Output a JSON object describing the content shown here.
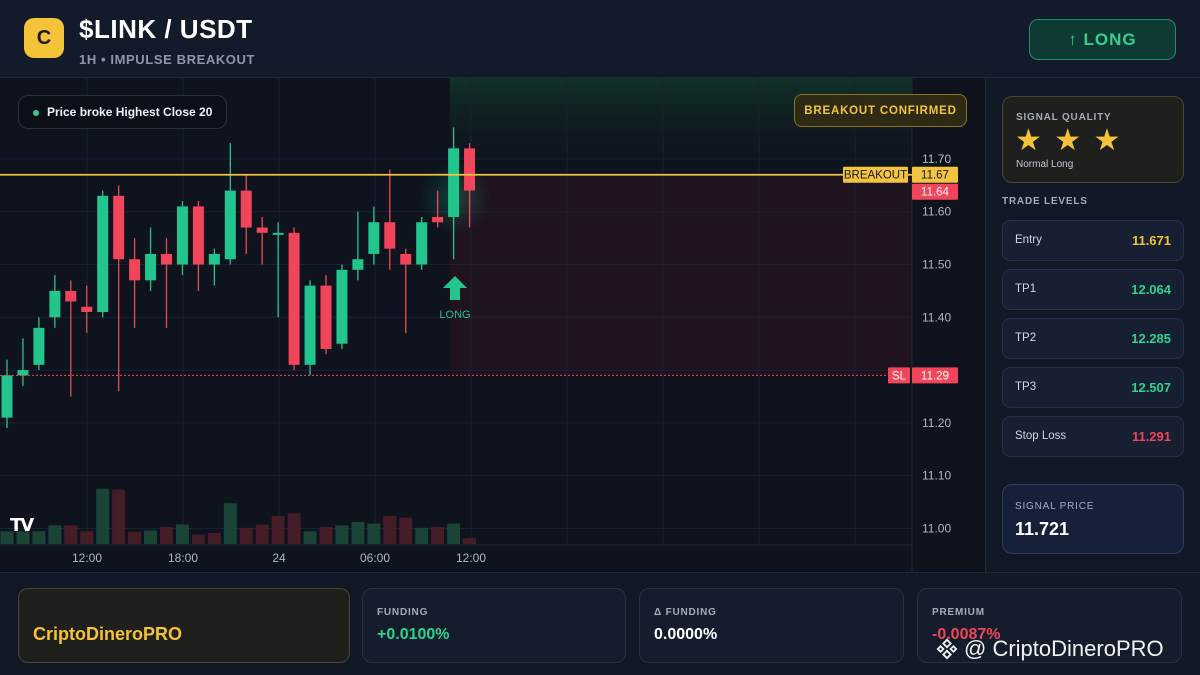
{
  "header": {
    "logo_letter": "C",
    "pair": "$LINK / USDT",
    "subtitle": "1H • IMPULSE BREAKOUT",
    "long_button": "↑ LONG"
  },
  "chart": {
    "info_pill": "Price broke Highest Close 20",
    "confirm_badge": "BREAKOUT CONFIRMED",
    "breakout_tag": "BREAKOUT",
    "breakout_value": "11.67",
    "last_price_value": "11.64",
    "sl_tag": "SL",
    "sl_value": "11.29",
    "long_marker_label": "LONG",
    "tv_logo": "TV"
  },
  "side": {
    "quality_label": "SIGNAL QUALITY",
    "quality_stars": "★ ★ ★",
    "quality_sub": "Normal Long",
    "levels_title": "TRADE LEVELS",
    "levels": [
      {
        "name": "Entry",
        "value": "11.671",
        "color": "#f5c338"
      },
      {
        "name": "TP1",
        "value": "12.064",
        "color": "#2ed28f"
      },
      {
        "name": "TP2",
        "value": "12.285",
        "color": "#2ed28f"
      },
      {
        "name": "TP3",
        "value": "12.507",
        "color": "#2ed28f"
      },
      {
        "name": "Stop Loss",
        "value": "11.291",
        "color": "#f0455a"
      }
    ],
    "signal_price_label": "SIGNAL PRICE",
    "signal_price_value": "11.721"
  },
  "bottom": {
    "brand": "CriptoDineroPRO",
    "funding_label": "FUNDING",
    "funding_value": "+0.0100%",
    "dfunding_label": "Δ FUNDING",
    "dfunding_value": "0.0000%",
    "premium_label": "PREMIUM",
    "premium_value": "-0.0087%",
    "watermark": "@ CriptoDineroPRO"
  },
  "colors": {
    "up": "#22c58b",
    "down": "#f0455a",
    "breakout": "#f2c440",
    "background": "#0e131d"
  },
  "chart_data": {
    "type": "candlestick",
    "y_ticks": [
      "11.70",
      "11.60",
      "11.50",
      "11.40",
      "11.20",
      "11.10",
      "11.00"
    ],
    "x_ticks": [
      "12:00",
      "18:00",
      "24",
      "06:00",
      "12:00"
    ],
    "ylim": [
      10.99,
      11.83
    ],
    "breakout_level": 11.67,
    "stop_loss_level": 11.29,
    "candles": [
      {
        "o": 11.21,
        "c": 11.29,
        "h": 11.32,
        "l": 11.19
      },
      {
        "o": 11.29,
        "c": 11.3,
        "h": 11.36,
        "l": 11.27
      },
      {
        "o": 11.31,
        "c": 11.38,
        "h": 11.4,
        "l": 11.3
      },
      {
        "o": 11.4,
        "c": 11.45,
        "h": 11.48,
        "l": 11.38
      },
      {
        "o": 11.45,
        "c": 11.43,
        "h": 11.47,
        "l": 11.25
      },
      {
        "o": 11.42,
        "c": 11.41,
        "h": 11.46,
        "l": 11.37
      },
      {
        "o": 11.41,
        "c": 11.63,
        "h": 11.64,
        "l": 11.4
      },
      {
        "o": 11.63,
        "c": 11.51,
        "h": 11.65,
        "l": 11.26
      },
      {
        "o": 11.51,
        "c": 11.47,
        "h": 11.55,
        "l": 11.38
      },
      {
        "o": 11.47,
        "c": 11.52,
        "h": 11.57,
        "l": 11.45
      },
      {
        "o": 11.52,
        "c": 11.5,
        "h": 11.55,
        "l": 11.38
      },
      {
        "o": 11.5,
        "c": 11.61,
        "h": 11.62,
        "l": 11.48
      },
      {
        "o": 11.61,
        "c": 11.5,
        "h": 11.62,
        "l": 11.45
      },
      {
        "o": 11.5,
        "c": 11.52,
        "h": 11.53,
        "l": 11.46
      },
      {
        "o": 11.51,
        "c": 11.64,
        "h": 11.73,
        "l": 11.5
      },
      {
        "o": 11.64,
        "c": 11.57,
        "h": 11.67,
        "l": 11.52
      },
      {
        "o": 11.57,
        "c": 11.56,
        "h": 11.59,
        "l": 11.5
      },
      {
        "o": 11.56,
        "c": 11.56,
        "h": 11.58,
        "l": 11.4
      },
      {
        "o": 11.56,
        "c": 11.31,
        "h": 11.57,
        "l": 11.3
      },
      {
        "o": 11.31,
        "c": 11.46,
        "h": 11.47,
        "l": 11.29
      },
      {
        "o": 11.46,
        "c": 11.34,
        "h": 11.48,
        "l": 11.33
      },
      {
        "o": 11.35,
        "c": 11.49,
        "h": 11.5,
        "l": 11.34
      },
      {
        "o": 11.49,
        "c": 11.51,
        "h": 11.6,
        "l": 11.47
      },
      {
        "o": 11.52,
        "c": 11.58,
        "h": 11.61,
        "l": 11.5
      },
      {
        "o": 11.58,
        "c": 11.53,
        "h": 11.68,
        "l": 11.49
      },
      {
        "o": 11.52,
        "c": 11.5,
        "h": 11.53,
        "l": 11.37
      },
      {
        "o": 11.5,
        "c": 11.58,
        "h": 11.59,
        "l": 11.49
      },
      {
        "o": 11.59,
        "c": 11.58,
        "h": 11.64,
        "l": 11.57
      },
      {
        "o": 11.59,
        "c": 11.72,
        "h": 11.76,
        "l": 11.51
      },
      {
        "o": 11.72,
        "c": 11.64,
        "h": 11.73,
        "l": 11.57
      }
    ],
    "volumes": [
      0.15,
      0.15,
      0.15,
      0.22,
      0.22,
      0.15,
      0.65,
      0.64,
      0.14,
      0.16,
      0.2,
      0.23,
      0.11,
      0.13,
      0.48,
      0.19,
      0.23,
      0.33,
      0.36,
      0.15,
      0.2,
      0.22,
      0.26,
      0.24,
      0.33,
      0.31,
      0.19,
      0.2,
      0.24,
      0.07
    ],
    "volume_up": [
      true,
      true,
      true,
      true,
      false,
      false,
      true,
      false,
      false,
      true,
      false,
      true,
      false,
      false,
      true,
      false,
      false,
      false,
      false,
      true,
      false,
      true,
      true,
      true,
      false,
      false,
      true,
      false,
      true,
      false
    ]
  }
}
